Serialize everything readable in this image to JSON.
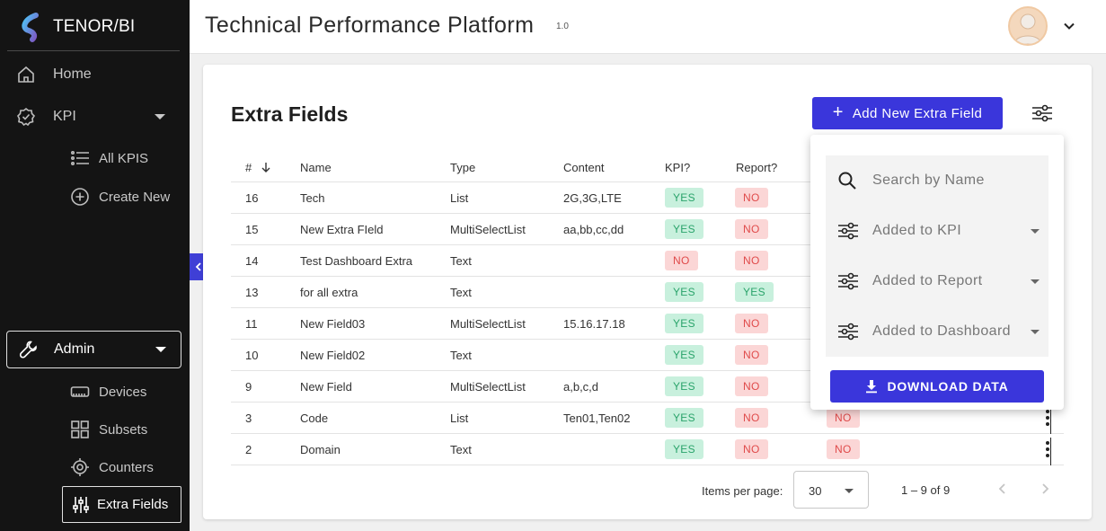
{
  "brand": {
    "name": "TENOR/BI"
  },
  "sidebar": {
    "home": "Home",
    "kpi": "KPI",
    "kpi_items": [
      {
        "label": "All KPIS",
        "icon": "list-icon"
      },
      {
        "label": "Create New",
        "icon": "plus-circle-icon"
      }
    ],
    "admin": "Admin",
    "admin_items": [
      {
        "label": "Devices",
        "icon": "device-icon"
      },
      {
        "label": "Subsets",
        "icon": "grid-icon"
      },
      {
        "label": "Counters",
        "icon": "target-icon"
      },
      {
        "label": "Extra Fields",
        "icon": "sliders-icon",
        "active": true
      }
    ]
  },
  "header": {
    "title": "Technical Performance Platform",
    "version": "1.0"
  },
  "page": {
    "title": "Extra Fields",
    "add_button": "Add New Extra Field"
  },
  "table": {
    "columns": [
      "#",
      "Name",
      "Type",
      "Content",
      "KPI?",
      "Report?"
    ],
    "rows": [
      {
        "id": "16",
        "name": "Tech",
        "type": "List",
        "content": "2G,3G,LTE",
        "kpi": "YES",
        "report": "NO",
        "dashboard": ""
      },
      {
        "id": "15",
        "name": "New Extra FIeld",
        "type": "MultiSelectList",
        "content": "aa,bb,cc,dd",
        "kpi": "YES",
        "report": "NO",
        "dashboard": ""
      },
      {
        "id": "14",
        "name": "Test Dashboard Extra",
        "type": "Text",
        "content": "",
        "kpi": "NO",
        "report": "NO",
        "dashboard": ""
      },
      {
        "id": "13",
        "name": "for all extra",
        "type": "Text",
        "content": "",
        "kpi": "YES",
        "report": "YES",
        "dashboard": ""
      },
      {
        "id": "11",
        "name": "New Field03",
        "type": "MultiSelectList",
        "content": "15.16.17.18",
        "kpi": "YES",
        "report": "NO",
        "dashboard": ""
      },
      {
        "id": "10",
        "name": "New Field02",
        "type": "Text",
        "content": "",
        "kpi": "YES",
        "report": "NO",
        "dashboard": ""
      },
      {
        "id": "9",
        "name": "New Field",
        "type": "MultiSelectList",
        "content": "a,b,c,d",
        "kpi": "YES",
        "report": "NO",
        "dashboard": ""
      },
      {
        "id": "3",
        "name": "Code",
        "type": "List",
        "content": "Ten01,Ten02",
        "kpi": "YES",
        "report": "NO",
        "dashboard": "NO"
      },
      {
        "id": "2",
        "name": "Domain",
        "type": "Text",
        "content": "",
        "kpi": "YES",
        "report": "NO",
        "dashboard": "NO"
      }
    ]
  },
  "paginator": {
    "label": "Items per page:",
    "page_size": "30",
    "range": "1 – 9 of 9"
  },
  "filters": {
    "search_placeholder": "Search by Name",
    "added_to_kpi": "Added to KPI",
    "added_to_report": "Added to Report",
    "added_to_dashboard": "Added to Dashboard",
    "download": "DOWNLOAD DATA"
  },
  "colors": {
    "sidebar_bg": "#141414",
    "accent": "#3a36db",
    "yes_bg": "#c8f0dd",
    "yes_text": "#2aa46b",
    "no_bg": "#fbd6d6",
    "no_text": "#e04b4b"
  }
}
